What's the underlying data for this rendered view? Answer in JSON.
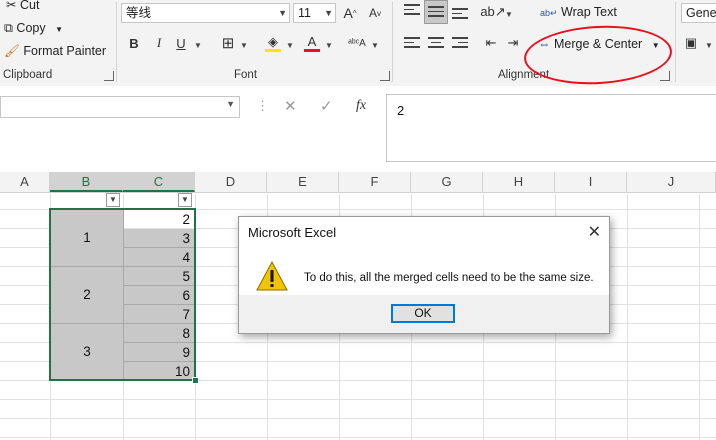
{
  "ribbon": {
    "clipboard": {
      "cut_label": "Cut",
      "copy_label": "Copy",
      "format_painter_label": "Format Painter",
      "group_label": "Clipboard"
    },
    "font": {
      "font_name": "等线",
      "font_size": "11",
      "group_label": "Font",
      "bold": "B",
      "italic": "I",
      "underline": "U"
    },
    "alignment": {
      "wrap_text_label": "Wrap Text",
      "merge_center_label": "Merge & Center",
      "group_label": "Alignment"
    },
    "number": {
      "format_value": "Gener"
    }
  },
  "formula_bar": {
    "fx_label": "fx",
    "value": "2"
  },
  "columns": [
    "A",
    "B",
    "C",
    "D",
    "E",
    "F",
    "G",
    "H",
    "I",
    "J"
  ],
  "merged_values": [
    "1",
    "2",
    "3"
  ],
  "column_c_values": [
    "2",
    "3",
    "4",
    "5",
    "6",
    "7",
    "8",
    "9",
    "10"
  ],
  "dialog": {
    "title": "Microsoft Excel",
    "message": "To do this, all the merged cells need to be the same size.",
    "ok_label": "OK"
  },
  "colors": {
    "excel_green": "#217346",
    "selection_gray": "#c8c8c8",
    "annotation_red": "#e8101c",
    "warning_yellow": "#f5c400"
  }
}
